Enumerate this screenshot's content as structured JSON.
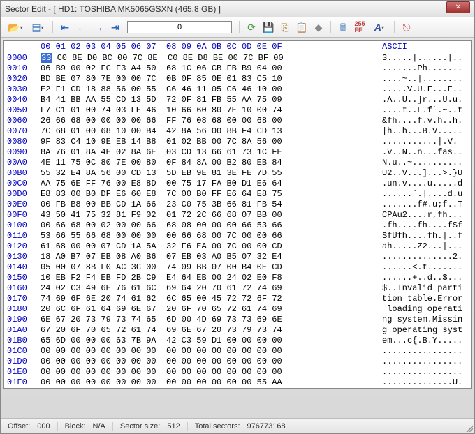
{
  "window": {
    "title": "Sector Edit - [ HD1: TOSHIBA MK5065GSXN (465.8 GB) ]"
  },
  "toolbar": {
    "sector_input": "0"
  },
  "header": {
    "blank": "    ",
    "cols": "00 01 02 03 04 05 06 07  08 09 0A 0B 0C 0D 0E 0F",
    "ascii": "ASCII"
  },
  "rows": [
    {
      "off": "0000",
      "b1": "33",
      "b2": " C0 8E D0 BC 00 7C 8E  C0 8E D8 BE 00 7C BF 00",
      "a": "3.....|......|.."
    },
    {
      "off": "0010",
      "b1": "06",
      "b2": " B9 00 02 FC F3 A4 50  68 1C 06 CB FB B9 04 00",
      "a": ".......Ph......."
    },
    {
      "off": "0020",
      "b1": "BD",
      "b2": " BE 07 80 7E 00 00 7C  0B 0F 85 0E 01 83 C5 10",
      "a": "....~..|........"
    },
    {
      "off": "0030",
      "b1": "E2",
      "b2": " F1 CD 18 88 56 00 55  C6 46 11 05 C6 46 10 00",
      "a": ".....V.U.F...F.."
    },
    {
      "off": "0040",
      "b1": "B4",
      "b2": " 41 BB AA 55 CD 13 5D  72 0F 81 FB 55 AA 75 09",
      "a": ".A..U..]r...U.u."
    },
    {
      "off": "0050",
      "b1": "F7",
      "b2": " C1 01 00 74 03 FE 46  10 66 60 80 7E 10 00 74",
      "a": "....t..F.f`.~..t"
    },
    {
      "off": "0060",
      "b1": "26",
      "b2": " 66 68 00 00 00 00 66  FF 76 08 68 00 00 68 00",
      "a": "&fh....f.v.h..h."
    },
    {
      "off": "0070",
      "b1": "7C",
      "b2": " 68 01 00 68 10 00 B4  42 8A 56 00 8B F4 CD 13",
      "a": "|h..h...B.V....."
    },
    {
      "off": "0080",
      "b1": "9F",
      "b2": " 83 C4 10 9E EB 14 B8  01 02 BB 00 7C 8A 56 00",
      "a": "...........|.V."
    },
    {
      "off": "0090",
      "b1": "8A",
      "b2": " 76 01 8A 4E 02 8A 6E  03 CD 13 66 61 73 1C FE",
      "a": ".v..N..n...fas.."
    },
    {
      "off": "00A0",
      "b1": "4E",
      "b2": " 11 75 0C 80 7E 00 80  0F 84 8A 00 B2 80 EB 84",
      "a": "N.u..~.........."
    },
    {
      "off": "00B0",
      "b1": "55",
      "b2": " 32 E4 8A 56 00 CD 13  5D EB 9E 81 3E FE 7D 55",
      "a": "U2..V...]...>.}U"
    },
    {
      "off": "00C0",
      "b1": "AA",
      "b2": " 75 6E FF 76 00 E8 8D  00 75 17 FA B0 D1 E6 64",
      "a": ".un.v....u.....d"
    },
    {
      "off": "00D0",
      "b1": "E8",
      "b2": " 83 00 B0 DF E6 60 E8  7C 00 B0 FF E6 64 E8 75",
      "a": "......`.|....d.u"
    },
    {
      "off": "00E0",
      "b1": "00",
      "b2": " FB B8 00 BB CD 1A 66  23 C0 75 3B 66 81 FB 54",
      "a": ".......f#.u;f..T"
    },
    {
      "off": "00F0",
      "b1": "43",
      "b2": " 50 41 75 32 81 F9 02  01 72 2C 66 68 07 BB 00",
      "a": "CPAu2....r,fh..."
    },
    {
      "off": "0100",
      "b1": "00",
      "b2": " 66 68 00 02 00 00 66  68 08 00 00 00 66 53 66",
      "a": ".fh....fh....fSf"
    },
    {
      "off": "0110",
      "b1": "53",
      "b2": " 66 55 66 68 00 00 00  00 66 68 00 7C 00 00 66",
      "a": "SfUfh....fh.|..f"
    },
    {
      "off": "0120",
      "b1": "61",
      "b2": " 68 00 00 07 CD 1A 5A  32 F6 EA 00 7C 00 00 CD",
      "a": "ah.....Z2...|..."
    },
    {
      "off": "0130",
      "b1": "18",
      "b2": " A0 B7 07 EB 08 A0 B6  07 EB 03 A0 B5 07 32 E4",
      "a": "..............2."
    },
    {
      "off": "0140",
      "b1": "05",
      "b2": " 00 07 8B F0 AC 3C 00  74 09 BB 07 00 B4 0E CD",
      "a": "......<.t......."
    },
    {
      "off": "0150",
      "b1": "10",
      "b2": " EB F2 F4 EB FD 2B C9  E4 64 EB 00 24 02 E0 F8",
      "a": "......+..d..$..."
    },
    {
      "off": "0160",
      "b1": "24",
      "b2": " 02 C3 49 6E 76 61 6C  69 64 20 70 61 72 74 69",
      "a": "$..Invalid parti"
    },
    {
      "off": "0170",
      "b1": "74",
      "b2": " 69 6F 6E 20 74 61 62  6C 65 00 45 72 72 6F 72",
      "a": "tion table.Error"
    },
    {
      "off": "0180",
      "b1": "20",
      "b2": " 6C 6F 61 64 69 6E 67  20 6F 70 65 72 61 74 69",
      "a": " loading operati"
    },
    {
      "off": "0190",
      "b1": "6E",
      "b2": " 67 20 73 79 73 74 65  6D 00 4D 69 73 73 69 6E",
      "a": "ng system.Missin"
    },
    {
      "off": "01A0",
      "b1": "67",
      "b2": " 20 6F 70 65 72 61 74  69 6E 67 20 73 79 73 74",
      "a": "g operating syst"
    },
    {
      "off": "01B0",
      "b1": "65",
      "b2": " 6D 00 00 00 63 7B 9A  42 C3 59 D1 00 00 00 00",
      "a": "em...c{.B.Y....."
    },
    {
      "off": "01C0",
      "b1": "00",
      "b2": " 00 00 00 00 00 00 00  00 00 00 00 00 00 00 00",
      "a": "................"
    },
    {
      "off": "01D0",
      "b1": "00",
      "b2": " 00 00 00 00 00 00 00  00 00 00 00 00 00 00 00",
      "a": "................"
    },
    {
      "off": "01E0",
      "b1": "00",
      "b2": " 00 00 00 00 00 00 00  00 00 00 00 00 00 00 00",
      "a": "................"
    },
    {
      "off": "01F0",
      "b1": "00",
      "b2": " 00 00 00 00 00 00 00  00 00 00 00 00 00 55 AA",
      "a": "..............U."
    }
  ],
  "status": {
    "offset_label": "Offset:",
    "offset_val": "000",
    "block_label": "Block:",
    "block_val": "N/A",
    "size_label": "Sector size:",
    "size_val": "512",
    "total_label": "Total sectors:",
    "total_val": "976773168"
  }
}
